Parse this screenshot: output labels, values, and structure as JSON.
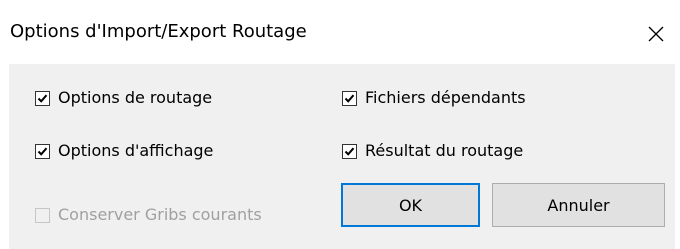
{
  "window": {
    "title": "Options d'Import/Export Routage"
  },
  "checkboxes": [
    {
      "label": "Options de routage",
      "checked": true,
      "enabled": true
    },
    {
      "label": "Fichiers dépendants",
      "checked": true,
      "enabled": true
    },
    {
      "label": "Options d'affichage",
      "checked": true,
      "enabled": true
    },
    {
      "label": "Résultat du routage",
      "checked": true,
      "enabled": true
    },
    {
      "label": "Conserver Gribs courants",
      "checked": false,
      "enabled": false
    }
  ],
  "buttons": {
    "ok_label": "OK",
    "cancel_label": "Annuler"
  },
  "colors": {
    "client_background": "#f0f0f0",
    "button_face": "#e1e1e1",
    "default_button_border": "#0078d7",
    "disabled_text": "#a0a0a0"
  },
  "icons": {
    "close": "close-icon",
    "check": "checkmark-icon"
  }
}
